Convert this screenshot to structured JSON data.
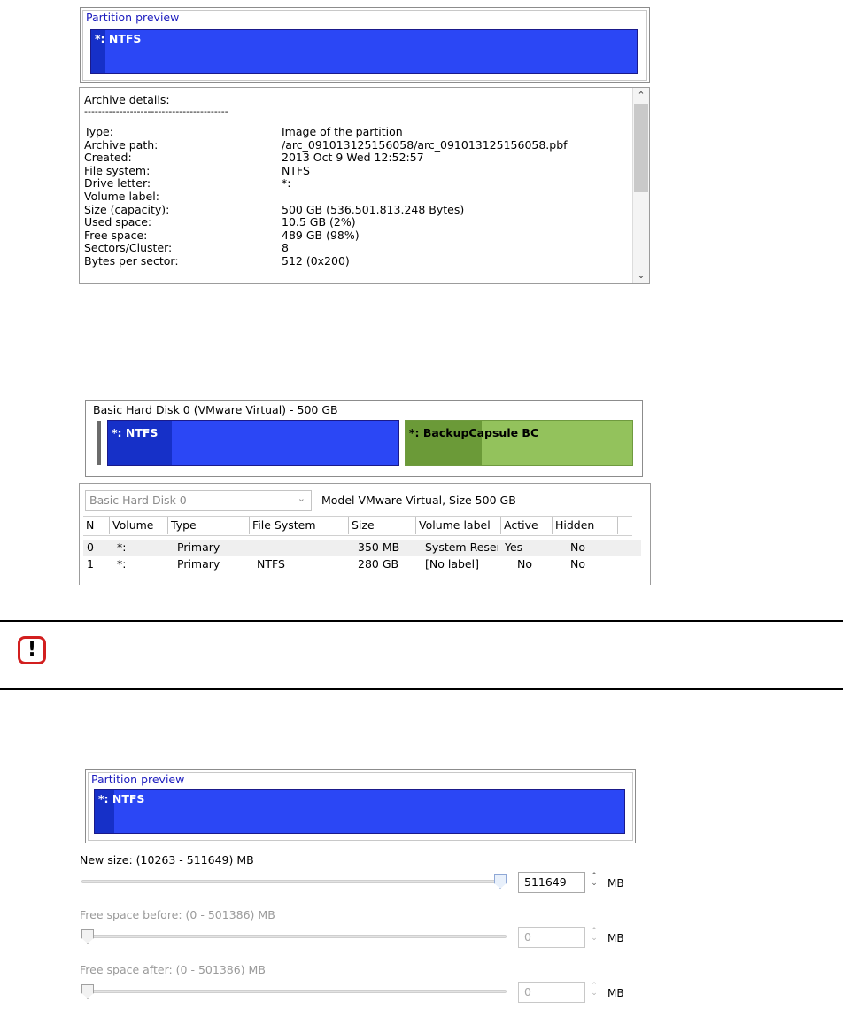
{
  "preview1": {
    "title": "Partition preview",
    "partition_label": "*: NTFS"
  },
  "details": {
    "heading": "Archive details:",
    "separator": "-----------------------------------------",
    "rows": [
      {
        "key": "Type:",
        "value": "Image of the partition"
      },
      {
        "key": "Archive path:",
        "value": "/arc_091013125156058/arc_091013125156058.pbf"
      },
      {
        "key": "Created:",
        "value": "2013 Oct 9 Wed 12:52:57"
      },
      {
        "key": "File system:",
        "value": "NTFS"
      },
      {
        "key": "Drive letter:",
        "value": "*:"
      },
      {
        "key": "Volume label:",
        "value": ""
      },
      {
        "key": "Size (capacity):",
        "value": "500 GB (536.501.813.248 Bytes)"
      },
      {
        "key": "Used space:",
        "value": "10.5 GB (2%)"
      },
      {
        "key": "Free space:",
        "value": "489 GB (98%)"
      },
      {
        "key": "Sectors/Cluster:",
        "value": "8"
      },
      {
        "key": "Bytes per sector:",
        "value": "512 (0x200)"
      }
    ]
  },
  "disk": {
    "title": "Basic Hard Disk 0 (VMware Virtual) - 500 GB",
    "seg1_label": "*: NTFS",
    "seg2_label": "*: BackupCapsule BC",
    "colors": {
      "ntfs": "#2b47f5",
      "ntfs_used": "#1630c8",
      "backup": "#93c25c",
      "backup_used": "#6b9a38"
    }
  },
  "table": {
    "combo_value": "Basic Hard Disk 0",
    "model_text": "Model VMware Virtual, Size 500 GB",
    "headers": [
      "N",
      "Volume",
      "Type",
      "File System",
      "Size",
      "Volume label",
      "Active",
      "Hidden"
    ],
    "rows": [
      [
        "0",
        "*:",
        "Primary",
        "",
        "350 MB",
        "System Resen",
        "Yes",
        "No"
      ],
      [
        "1",
        "*:",
        "Primary",
        "NTFS",
        "280 GB",
        "[No label]",
        "No",
        "No"
      ]
    ]
  },
  "warning": {
    "icon_glyph": "!",
    "accent_color": "#d21f1f"
  },
  "preview2": {
    "title": "Partition preview",
    "partition_label": "*: NTFS"
  },
  "resize": {
    "new_size_caption": "New size: (10263 - 511649) MB",
    "new_size_value": "511649",
    "new_size_fraction": 1.0,
    "before_caption": "Free space before: (0 - 501386) MB",
    "before_value": "0",
    "before_fraction": 0.0,
    "after_caption": "Free space after: (0 - 501386) MB",
    "after_value": "0",
    "after_fraction": 0.0,
    "unit": "MB"
  }
}
